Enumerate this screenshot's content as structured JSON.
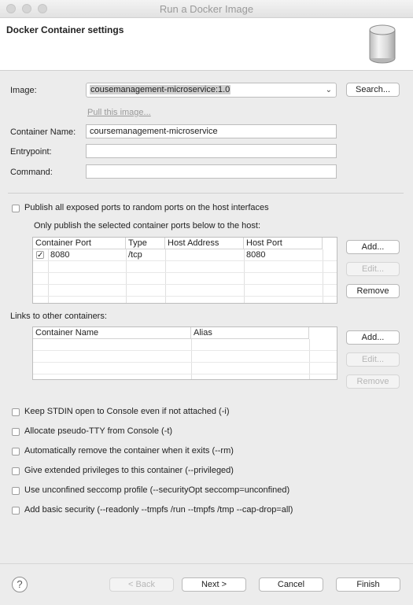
{
  "window": {
    "title": "Run a Docker Image"
  },
  "header": {
    "title": "Docker Container settings",
    "icon": "docker-cylinder-icon"
  },
  "image": {
    "label": "Image:",
    "value": "cousemanagement-microservice:1.0",
    "search_button": "Search...",
    "pull_link": "Pull this image..."
  },
  "container_name": {
    "label": "Container Name:",
    "value": "coursemanagement-microservice"
  },
  "entrypoint": {
    "label": "Entrypoint:",
    "value": ""
  },
  "command": {
    "label": "Command:",
    "value": ""
  },
  "ports": {
    "publish_all_label": "Publish all exposed ports to random ports on the host interfaces",
    "publish_all_checked": false,
    "only_publish_label": "Only publish the selected container ports below to the host:",
    "columns": [
      "Container Port",
      "Type",
      "Host Address",
      "Host Port"
    ],
    "rows": [
      {
        "checked": true,
        "container_port": "8080",
        "type": "/tcp",
        "host_address": "",
        "host_port": "8080"
      }
    ],
    "buttons": {
      "add": "Add...",
      "edit": "Edit...",
      "remove": "Remove"
    }
  },
  "links": {
    "label": "Links to other containers:",
    "columns": [
      "Container Name",
      "Alias"
    ],
    "buttons": {
      "add": "Add...",
      "edit": "Edit...",
      "remove": "Remove"
    }
  },
  "options": [
    {
      "label": "Keep STDIN open to Console even if not attached (-i)",
      "checked": false
    },
    {
      "label": "Allocate pseudo-TTY from Console (-t)",
      "checked": false
    },
    {
      "label": "Automatically remove the container when it exits (--rm)",
      "checked": false
    },
    {
      "label": "Give extended privileges to this container (--privileged)",
      "checked": false
    },
    {
      "label": "Use unconfined seccomp profile (--securityOpt seccomp=unconfined)",
      "checked": false
    },
    {
      "label": "Add basic security (--readonly --tmpfs /run --tmpfs /tmp --cap-drop=all)",
      "checked": false
    }
  ],
  "footer": {
    "help": "?",
    "back": "< Back",
    "next": "Next >",
    "cancel": "Cancel",
    "finish": "Finish"
  },
  "colors": {
    "window_bg": "#ececec",
    "header_bg": "#ffffff",
    "disabled_text": "#b6b6b6"
  }
}
